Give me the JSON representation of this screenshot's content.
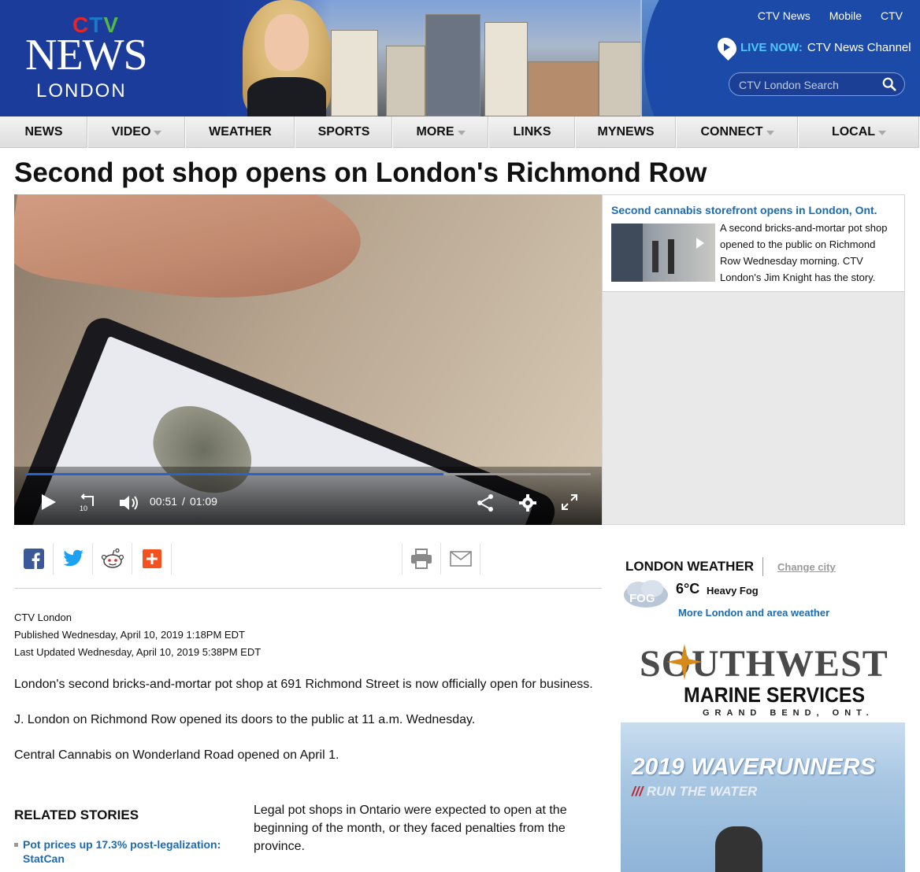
{
  "header": {
    "brand_ctv": "CTV",
    "brand_news": "NEWS",
    "brand_city": "LONDON",
    "top_links": [
      "CTV News",
      "Mobile",
      "CTV"
    ],
    "live_label": "LIVE NOW:",
    "live_text": "CTV News Channel",
    "search_placeholder": "CTV London Search",
    "colors": {
      "bar": "#1c4aa8",
      "live": "#4fc8ff",
      "ctv_c": "#e4262a",
      "ctv_t": "#1d78c8",
      "ctv_v": "#52b846"
    }
  },
  "nav": [
    {
      "label": "NEWS",
      "dropdown": false
    },
    {
      "label": "VIDEO",
      "dropdown": true
    },
    {
      "label": "WEATHER",
      "dropdown": false
    },
    {
      "label": "SPORTS",
      "dropdown": false
    },
    {
      "label": "MORE",
      "dropdown": true
    },
    {
      "label": "LINKS",
      "dropdown": false
    },
    {
      "label": "MYNEWS",
      "dropdown": false
    },
    {
      "label": "CONNECT",
      "dropdown": true
    },
    {
      "label": "LOCAL",
      "dropdown": true
    }
  ],
  "article": {
    "headline": "Second pot shop opens on London's Richmond Row",
    "source": "CTV London",
    "published": "Published Wednesday, April 10, 2019 1:18PM EDT",
    "updated": "Last Updated Wednesday, April 10, 2019 5:38PM EDT",
    "paragraphs": [
      "London's second bricks-and-mortar pot shop at 691 Richmond Street is now officially open for business.",
      "J. London on Richmond Row opened its doors to the public at 11 a.m. Wednesday.",
      "Central Cannabis on Wonderland Road opened on April 1."
    ],
    "legal_paragraph": "Legal pot shops in Ontario were expected to open at the beginning of the month, or they faced penalties from the province."
  },
  "video": {
    "current_time": "00:51",
    "separator": "/",
    "duration": "01:09",
    "progress_fraction": 0.74,
    "skip_label": "10"
  },
  "related_video": {
    "title": "Second cannabis storefront opens in London, Ont.",
    "description": "A second bricks-and-mortar pot shop opened to the public on Richmond Row Wednesday morning. CTV London's Jim Knight has the story."
  },
  "related_stories": {
    "heading": "RELATED STORIES",
    "items": [
      "Pot prices up 17.3% post-legalization: StatCan"
    ]
  },
  "weather": {
    "title": "LONDON WEATHER",
    "change_link": "Change city",
    "icon_label": "FOG",
    "temp": "6°C",
    "condition": "Heavy Fog",
    "more_link": "More London and area weather"
  },
  "ad": {
    "brand": "SOUTHWEST",
    "subtitle": "MARINE SERVICES",
    "location": "GRAND BEND, ONT.",
    "headline": "2019 WAVERUNNERS",
    "tag_slashes": "///",
    "tagline": "RUN THE WATER"
  }
}
